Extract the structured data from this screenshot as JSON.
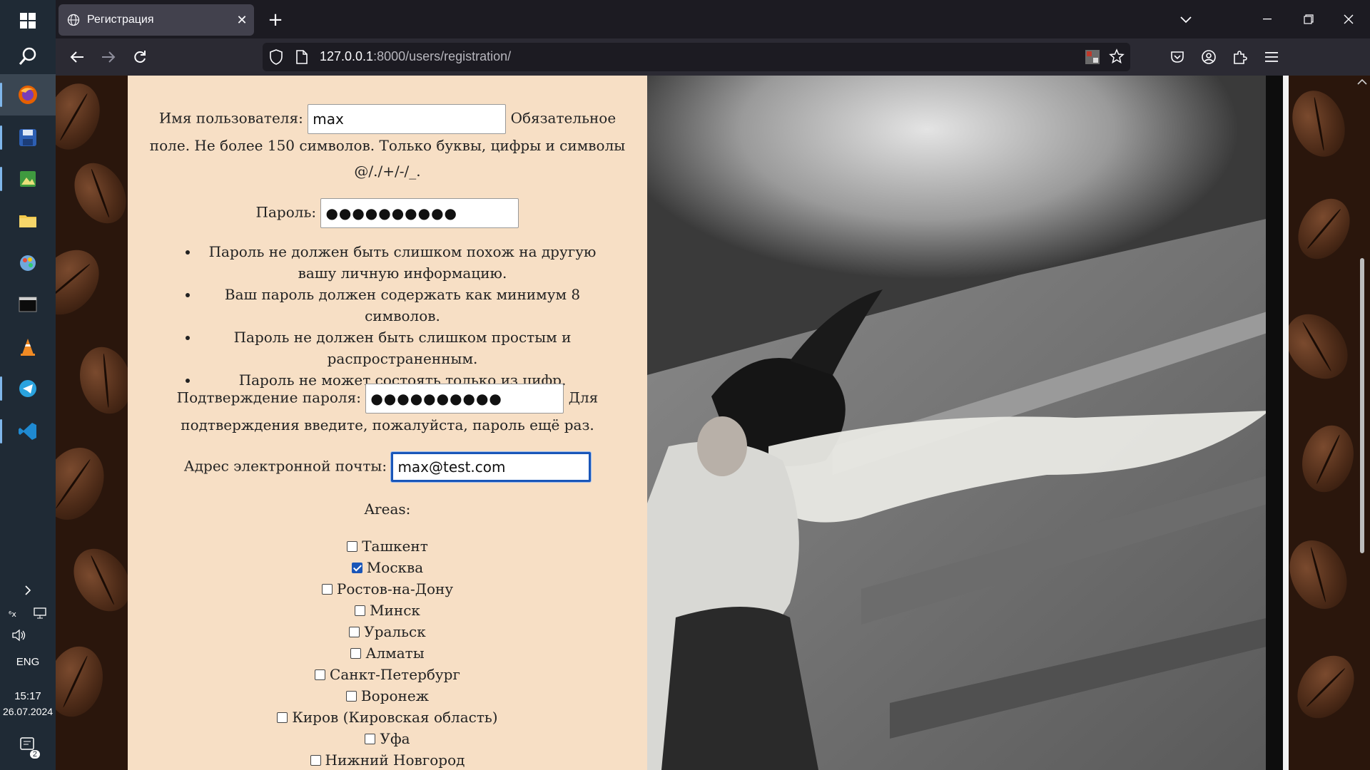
{
  "taskbar": {
    "apps": [
      {
        "name": "Windows",
        "icon": "windows-icon"
      },
      {
        "name": "Search",
        "icon": "search-icon"
      },
      {
        "name": "Firefox",
        "icon": "firefox-icon",
        "active": true
      },
      {
        "name": "Save",
        "icon": "floppy-disk-icon"
      },
      {
        "name": "Image viewer",
        "icon": "image-viewer-icon"
      },
      {
        "name": "File Explorer",
        "icon": "folder-icon"
      },
      {
        "name": "Paint",
        "icon": "paint-icon"
      },
      {
        "name": "Terminal",
        "icon": "terminal-icon"
      },
      {
        "name": "VLC",
        "icon": "vlc-cone-icon"
      },
      {
        "name": "Telegram",
        "icon": "telegram-icon"
      },
      {
        "name": "VS Code",
        "icon": "vscode-icon"
      }
    ],
    "lang": "ENG",
    "time": "15:17",
    "date": "26.07.2024",
    "notifications": "2"
  },
  "browser": {
    "tab_title": "Регистрация",
    "url_host": "127.0.0.1",
    "url_path": ":8000/users/registration/"
  },
  "form": {
    "username_label": "Имя пользователя:",
    "username_value": "max",
    "username_help_1": "Обязательное",
    "username_help_2": "поле. Не более 150 символов. Только буквы, цифры и символы",
    "username_help_3": "@/./+/-/_.",
    "password_label": "Пароль:",
    "password_value": "●●●●●●●●●●",
    "password_hints": [
      "Пароль не должен быть слишком похож на другую вашу личную информацию.",
      "Ваш пароль должен содержать как минимум 8 символов.",
      "Пароль не должен быть слишком простым и распространенным.",
      "Пароль не может состоять только из цифр."
    ],
    "confirm_label": "Подтверждение пароля:",
    "confirm_value": "●●●●●●●●●●",
    "confirm_help_1": "Для",
    "confirm_help_2": "подтверждения введите, пожалуйста, пароль ещё раз.",
    "email_label": "Адрес электронной почты:",
    "email_value": "max@test.com",
    "areas_label": "Areas:",
    "areas": [
      {
        "label": "Ташкент",
        "checked": false
      },
      {
        "label": "Москва",
        "checked": true
      },
      {
        "label": "Ростов-на-Дону",
        "checked": false
      },
      {
        "label": "Минск",
        "checked": false
      },
      {
        "label": "Уральск",
        "checked": false
      },
      {
        "label": "Алматы",
        "checked": false
      },
      {
        "label": "Санкт-Петербург",
        "checked": false
      },
      {
        "label": "Воронеж",
        "checked": false
      },
      {
        "label": "Киров (Кировская область)",
        "checked": false
      },
      {
        "label": "Уфа",
        "checked": false
      },
      {
        "label": "Нижний Новгород",
        "checked": false
      }
    ]
  }
}
